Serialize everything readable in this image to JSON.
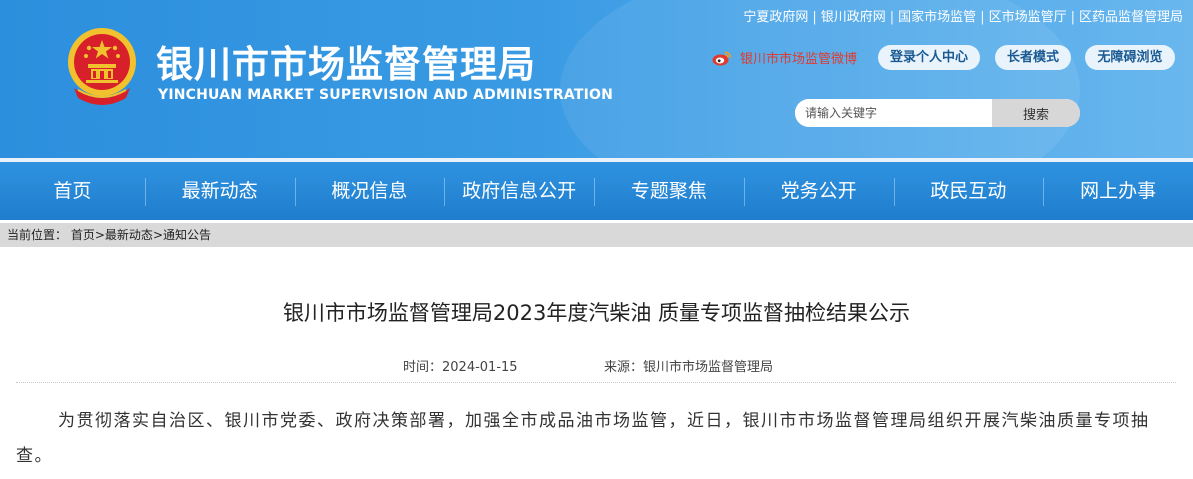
{
  "header": {
    "title": "银川市市场监督管理局",
    "subtitle": "YINCHUAN MARKET SUPERVISION AND ADMINISTRATION",
    "top_links": [
      "宁夏政府网",
      "银川政府网",
      "国家市场监管",
      "区市场监管厅",
      "区药品监督管理局"
    ],
    "separator": "|",
    "weibo_label": "银川市市场监管微博",
    "buttons": {
      "login": "登录个人中心",
      "elder": "长者模式",
      "accessible": "无障碍浏览"
    },
    "search": {
      "placeholder": "请输入关键字",
      "button": "搜索"
    },
    "colors": {
      "banner": "#3a9be4",
      "weibo": "#e03a2f",
      "emblem_red": "#d8202a",
      "emblem_gold": "#f2c12e"
    }
  },
  "nav": {
    "items": [
      "首页",
      "最新动态",
      "概况信息",
      "政府信息公开",
      "专题聚焦",
      "党务公开",
      "政民互动",
      "网上办事"
    ]
  },
  "breadcrumb": {
    "prefix": "当前位置：",
    "items": [
      "首页",
      "最新动态",
      "通知公告"
    ],
    "separator": ">"
  },
  "article": {
    "title": "银川市市场监督管理局2023年度汽柴油 质量专项监督抽检结果公示",
    "time": "时间：2024-01-15",
    "source": "来源：银川市市场监督管理局",
    "paragraph": "为贯彻落实自治区、银川市党委、政府决策部署，加强全市成品油市场监管，近日，银川市市场监督管理局组织开展汽柴油质量专项抽查。"
  }
}
